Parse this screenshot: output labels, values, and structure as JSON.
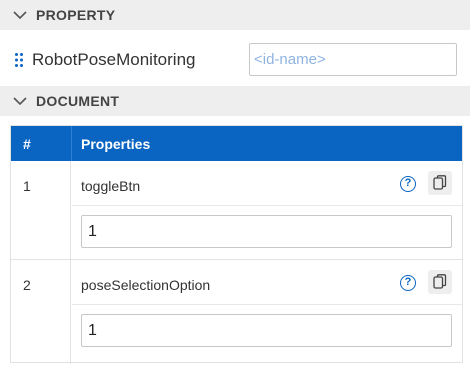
{
  "sections": {
    "property_header": "PROPERTY",
    "document_header": "DOCUMENT"
  },
  "property": {
    "name": "RobotPoseMonitoring",
    "id_placeholder": "<id-name>",
    "id_value": ""
  },
  "table": {
    "col_index": "#",
    "col_properties": "Properties",
    "rows": [
      {
        "index": "1",
        "key": "toggleBtn",
        "value": "1"
      },
      {
        "index": "2",
        "key": "poseSelectionOption",
        "value": "1"
      }
    ]
  },
  "icons": {
    "collapse": "chevron-down-icon",
    "drag": "drag-handle-icon",
    "help": "help-circle-icon",
    "copy": "copy-icon"
  },
  "colors": {
    "accent": "#0a64c2",
    "header_bg": "#eeeeee"
  }
}
